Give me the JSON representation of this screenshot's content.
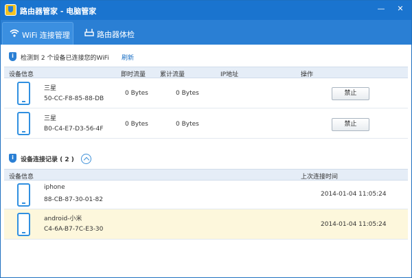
{
  "window": {
    "title": "路由器管家 - 电脑管家",
    "min_glyph": "—",
    "close_glyph": "✕"
  },
  "tabs": [
    {
      "label": "WiFi 连接管理",
      "icon": "wifi-icon",
      "active": true
    },
    {
      "label": "路由器体检",
      "icon": "router-icon",
      "active": false
    }
  ],
  "notice": {
    "text": "检测到 2 个设备已连接您的WiFi",
    "refresh": "刷新"
  },
  "connected": {
    "headers": {
      "device": "设备信息",
      "realtime": "即时流量",
      "total": "累计流量",
      "ip": "IP地址",
      "action": "操作"
    },
    "rows": [
      {
        "name": "三星",
        "mac": "50-CC-F8-85-88-DB",
        "realtime": "0 Bytes",
        "total": "0 Bytes",
        "ip": "",
        "action": "禁止"
      },
      {
        "name": "三星",
        "mac": "B0-C4-E7-D3-56-4F",
        "realtime": "0 Bytes",
        "total": "0 Bytes",
        "ip": "",
        "action": "禁止"
      }
    ]
  },
  "history": {
    "title": "设备连接记录 ( 2 )",
    "headers": {
      "device": "设备信息",
      "last_time": "上次连接时间"
    },
    "rows": [
      {
        "name": "iphone",
        "mac": "88-CB-87-30-01-82",
        "last_time": "2014-01-04 11:05:24",
        "highlight": false
      },
      {
        "name": "android-小米",
        "mac": "C4-6A-B7-7C-E3-30",
        "last_time": "2014-01-04 11:05:24",
        "highlight": true
      }
    ]
  },
  "colors": {
    "title_bar": "#1a74cf",
    "tab_bar": "#2a7fd4",
    "accent": "#2f8fe0",
    "highlight_row": "#fdf7dc",
    "header_row": "#e5edf7"
  }
}
